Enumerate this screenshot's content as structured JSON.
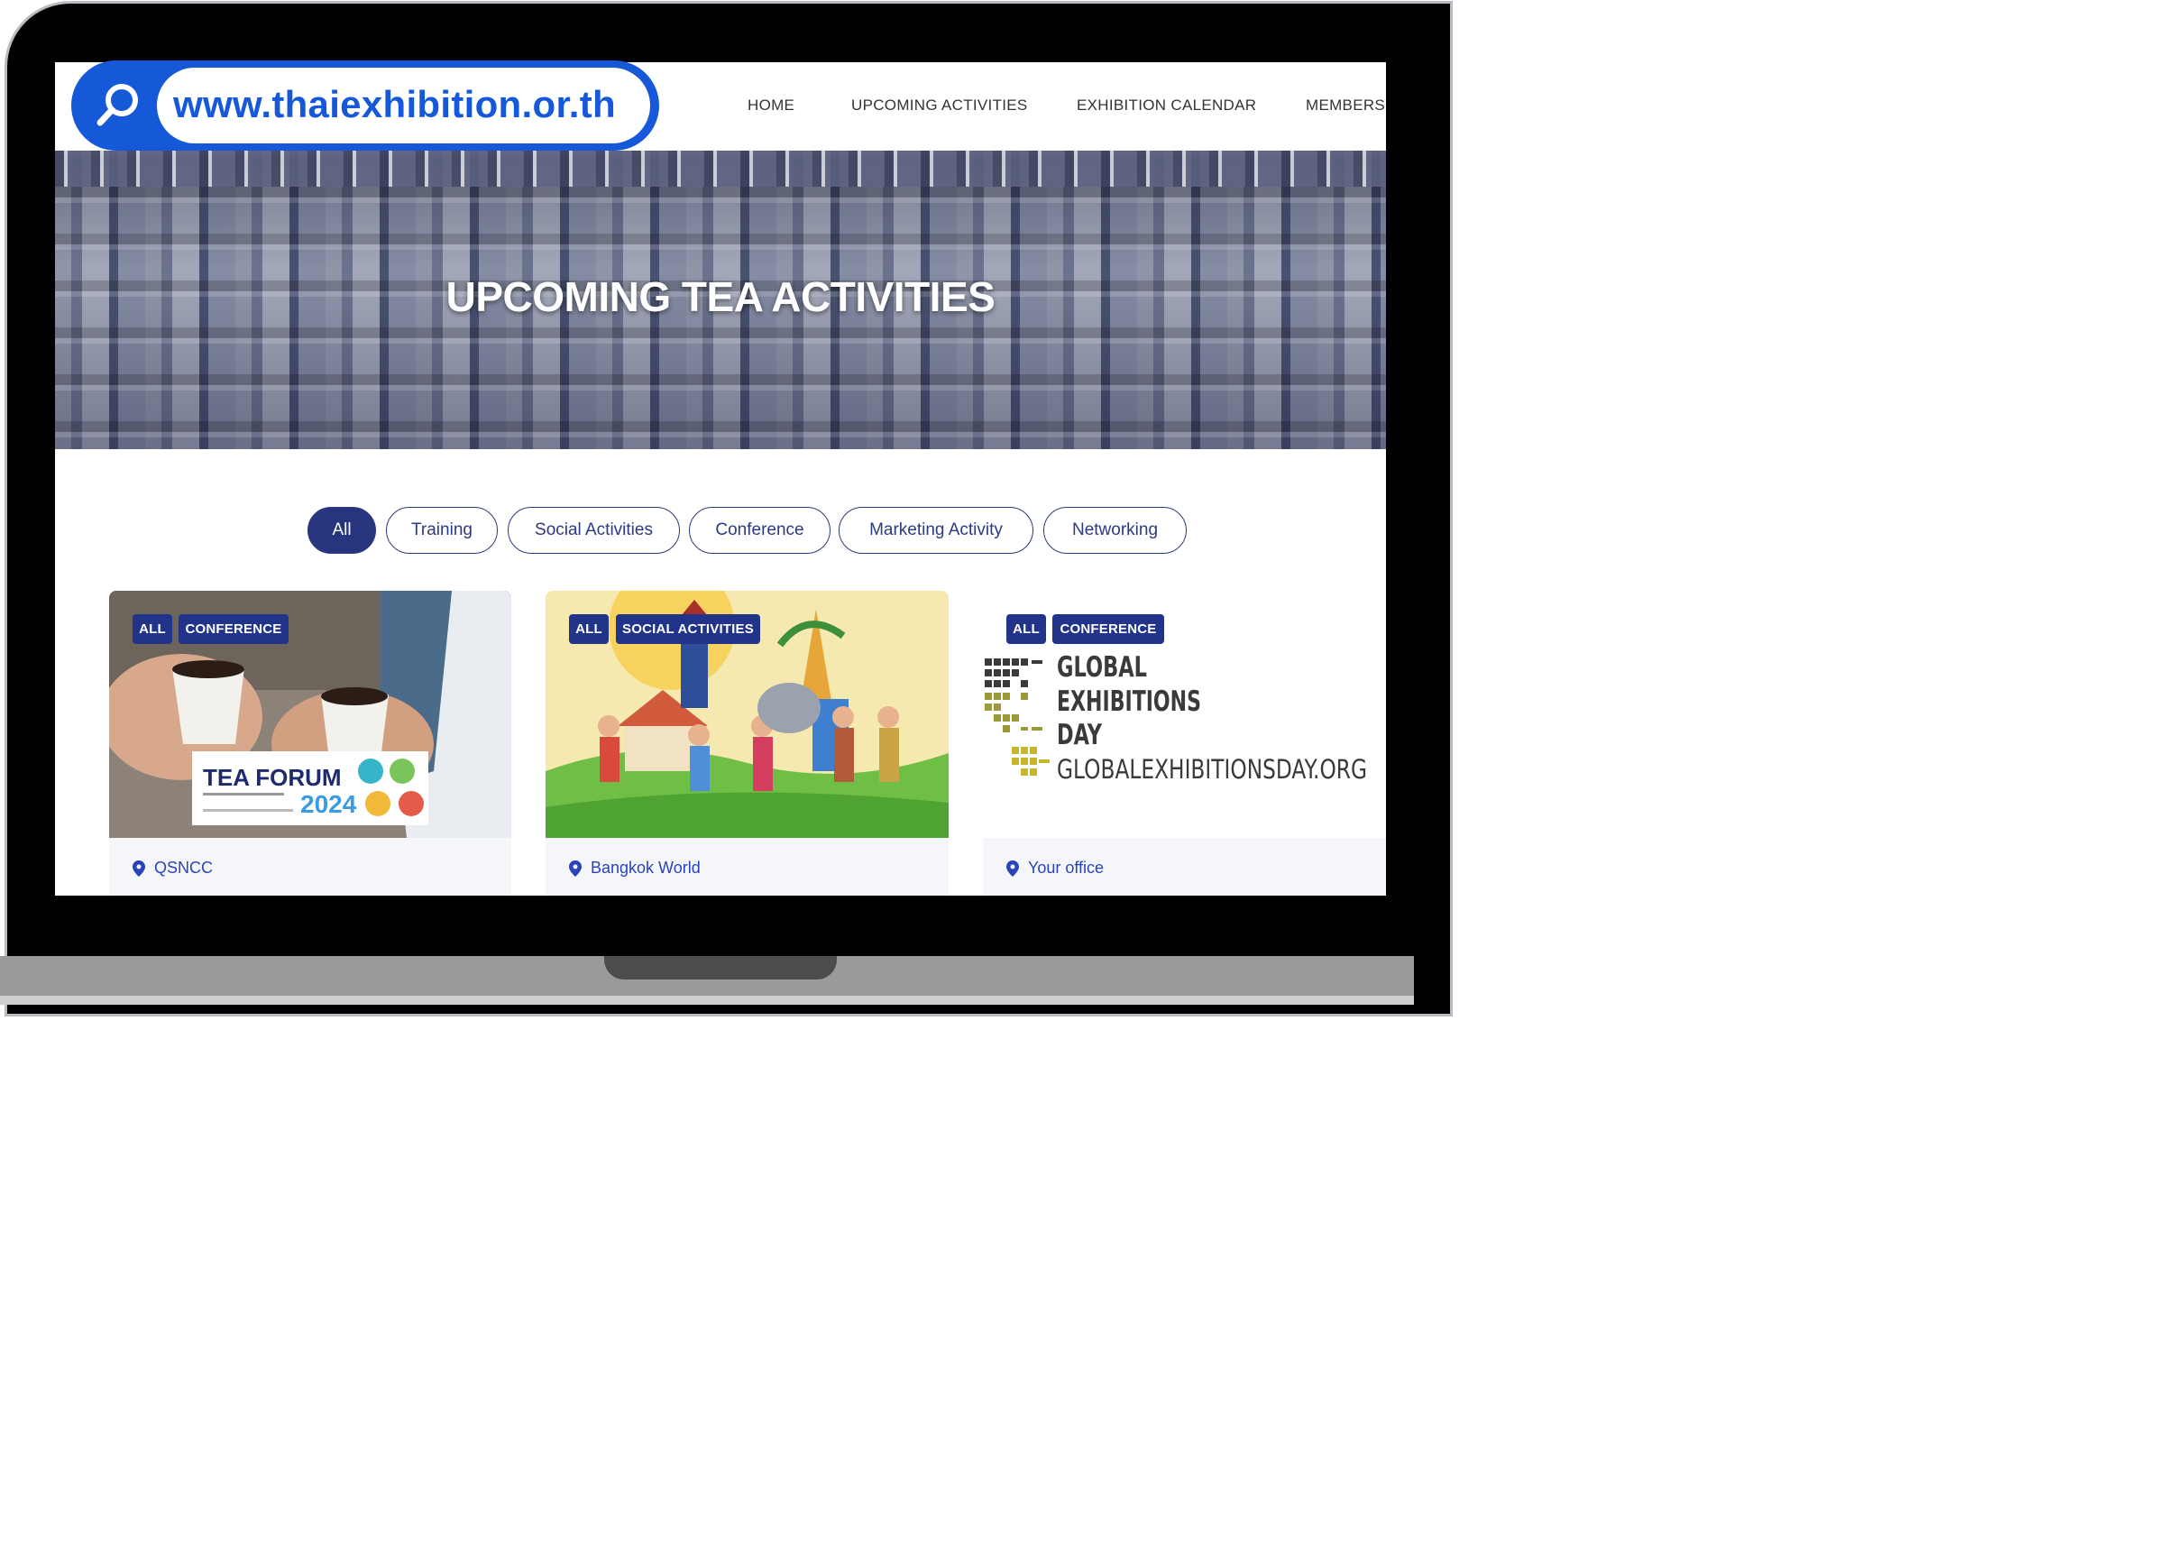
{
  "browser": {
    "url": "www.thaiexhibition.or.th"
  },
  "nav": {
    "items": [
      {
        "label": "HOME"
      },
      {
        "label": "UPCOMING ACTIVITIES"
      },
      {
        "label": "EXHIBITION CALENDAR"
      },
      {
        "label": "MEMBERSH"
      }
    ]
  },
  "hero": {
    "title": "UPCOMING TEA ACTIVITIES"
  },
  "filters": [
    {
      "label": "All",
      "active": true
    },
    {
      "label": "Training",
      "active": false
    },
    {
      "label": "Social Activities",
      "active": false
    },
    {
      "label": "Conference",
      "active": false
    },
    {
      "label": "Marketing Activity",
      "active": false
    },
    {
      "label": "Networking",
      "active": false
    }
  ],
  "cards": [
    {
      "tags": [
        "ALL",
        "CONFERENCE"
      ],
      "location": "QSNCC",
      "image_text": {
        "title": "TEA FORUM",
        "year": "2024"
      }
    },
    {
      "tags": [
        "ALL",
        "SOCIAL ACTIVITIES"
      ],
      "location": "Bangkok World"
    },
    {
      "tags": [
        "ALL",
        "CONFERENCE"
      ],
      "location": "Your office",
      "image_text": {
        "line1": "GLOBAL",
        "line2": "EXHIBITIONS",
        "line3": "DAY",
        "line4": "GLOBALEXHIBITIONSDAY.ORG"
      }
    }
  ],
  "colors": {
    "brand_blue": "#1559d8",
    "navy": "#26357e",
    "badge": "#22338a"
  }
}
